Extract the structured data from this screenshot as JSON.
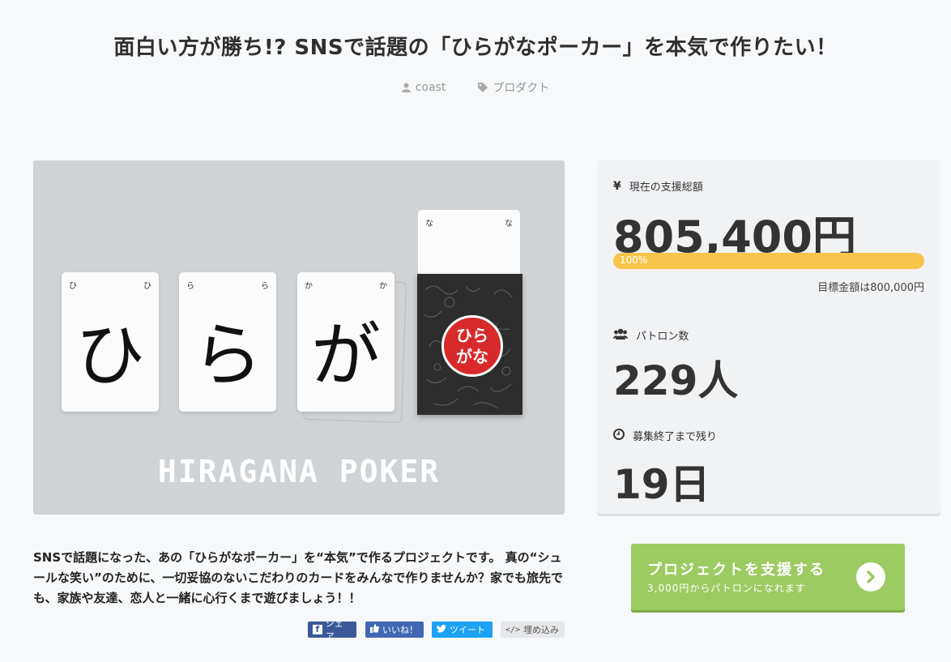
{
  "page": {
    "title": "面白い方が勝ち!? SNSで話題の「ひらがなポーカー」を本気で作りたい！",
    "author": "coast",
    "category": "プロダクト"
  },
  "hero": {
    "cards": [
      {
        "char": "ひ",
        "corner": "ひ"
      },
      {
        "char": "ら",
        "corner": "ら"
      },
      {
        "char": "が",
        "corner": "か"
      }
    ],
    "box_top_corner": "な",
    "seal_text": "ひらがな",
    "logo_text": "HIRAGANA POKER"
  },
  "stats": {
    "amount_label": "現在の支援総額",
    "amount_value": "805,400円",
    "progress_percent": 100,
    "progress_text": "100%",
    "goal_text": "目標金額は800,000円",
    "patrons_label": "パトロン数",
    "patrons_value": "229人",
    "remaining_label": "募集終了まで残り",
    "remaining_value": "19日"
  },
  "description": {
    "text": "SNSで話題になった、あの「ひらがなポーカー」を“本気”で作るプロジェクトです。 真の“シュールな笑い”のために、一切妥協のないこだわりのカードをみんなで作りませんか？家でも旅先でも、家族や友達、恋人と一緒に心行くまで遊びましょう！！"
  },
  "share": {
    "facebook_share": "シェア",
    "facebook_like": "いいね！",
    "twitter": "ツイート",
    "embed": "埋め込み"
  },
  "cta": {
    "title": "プロジェクトを支援する",
    "subtitle": "3,000円からパトロンになれます"
  },
  "colors": {
    "background": "#f6f8fa",
    "progress": "#f7c54a",
    "cta": "#9ccb62",
    "facebook": "#3b5998",
    "twitter": "#1da1f2"
  }
}
